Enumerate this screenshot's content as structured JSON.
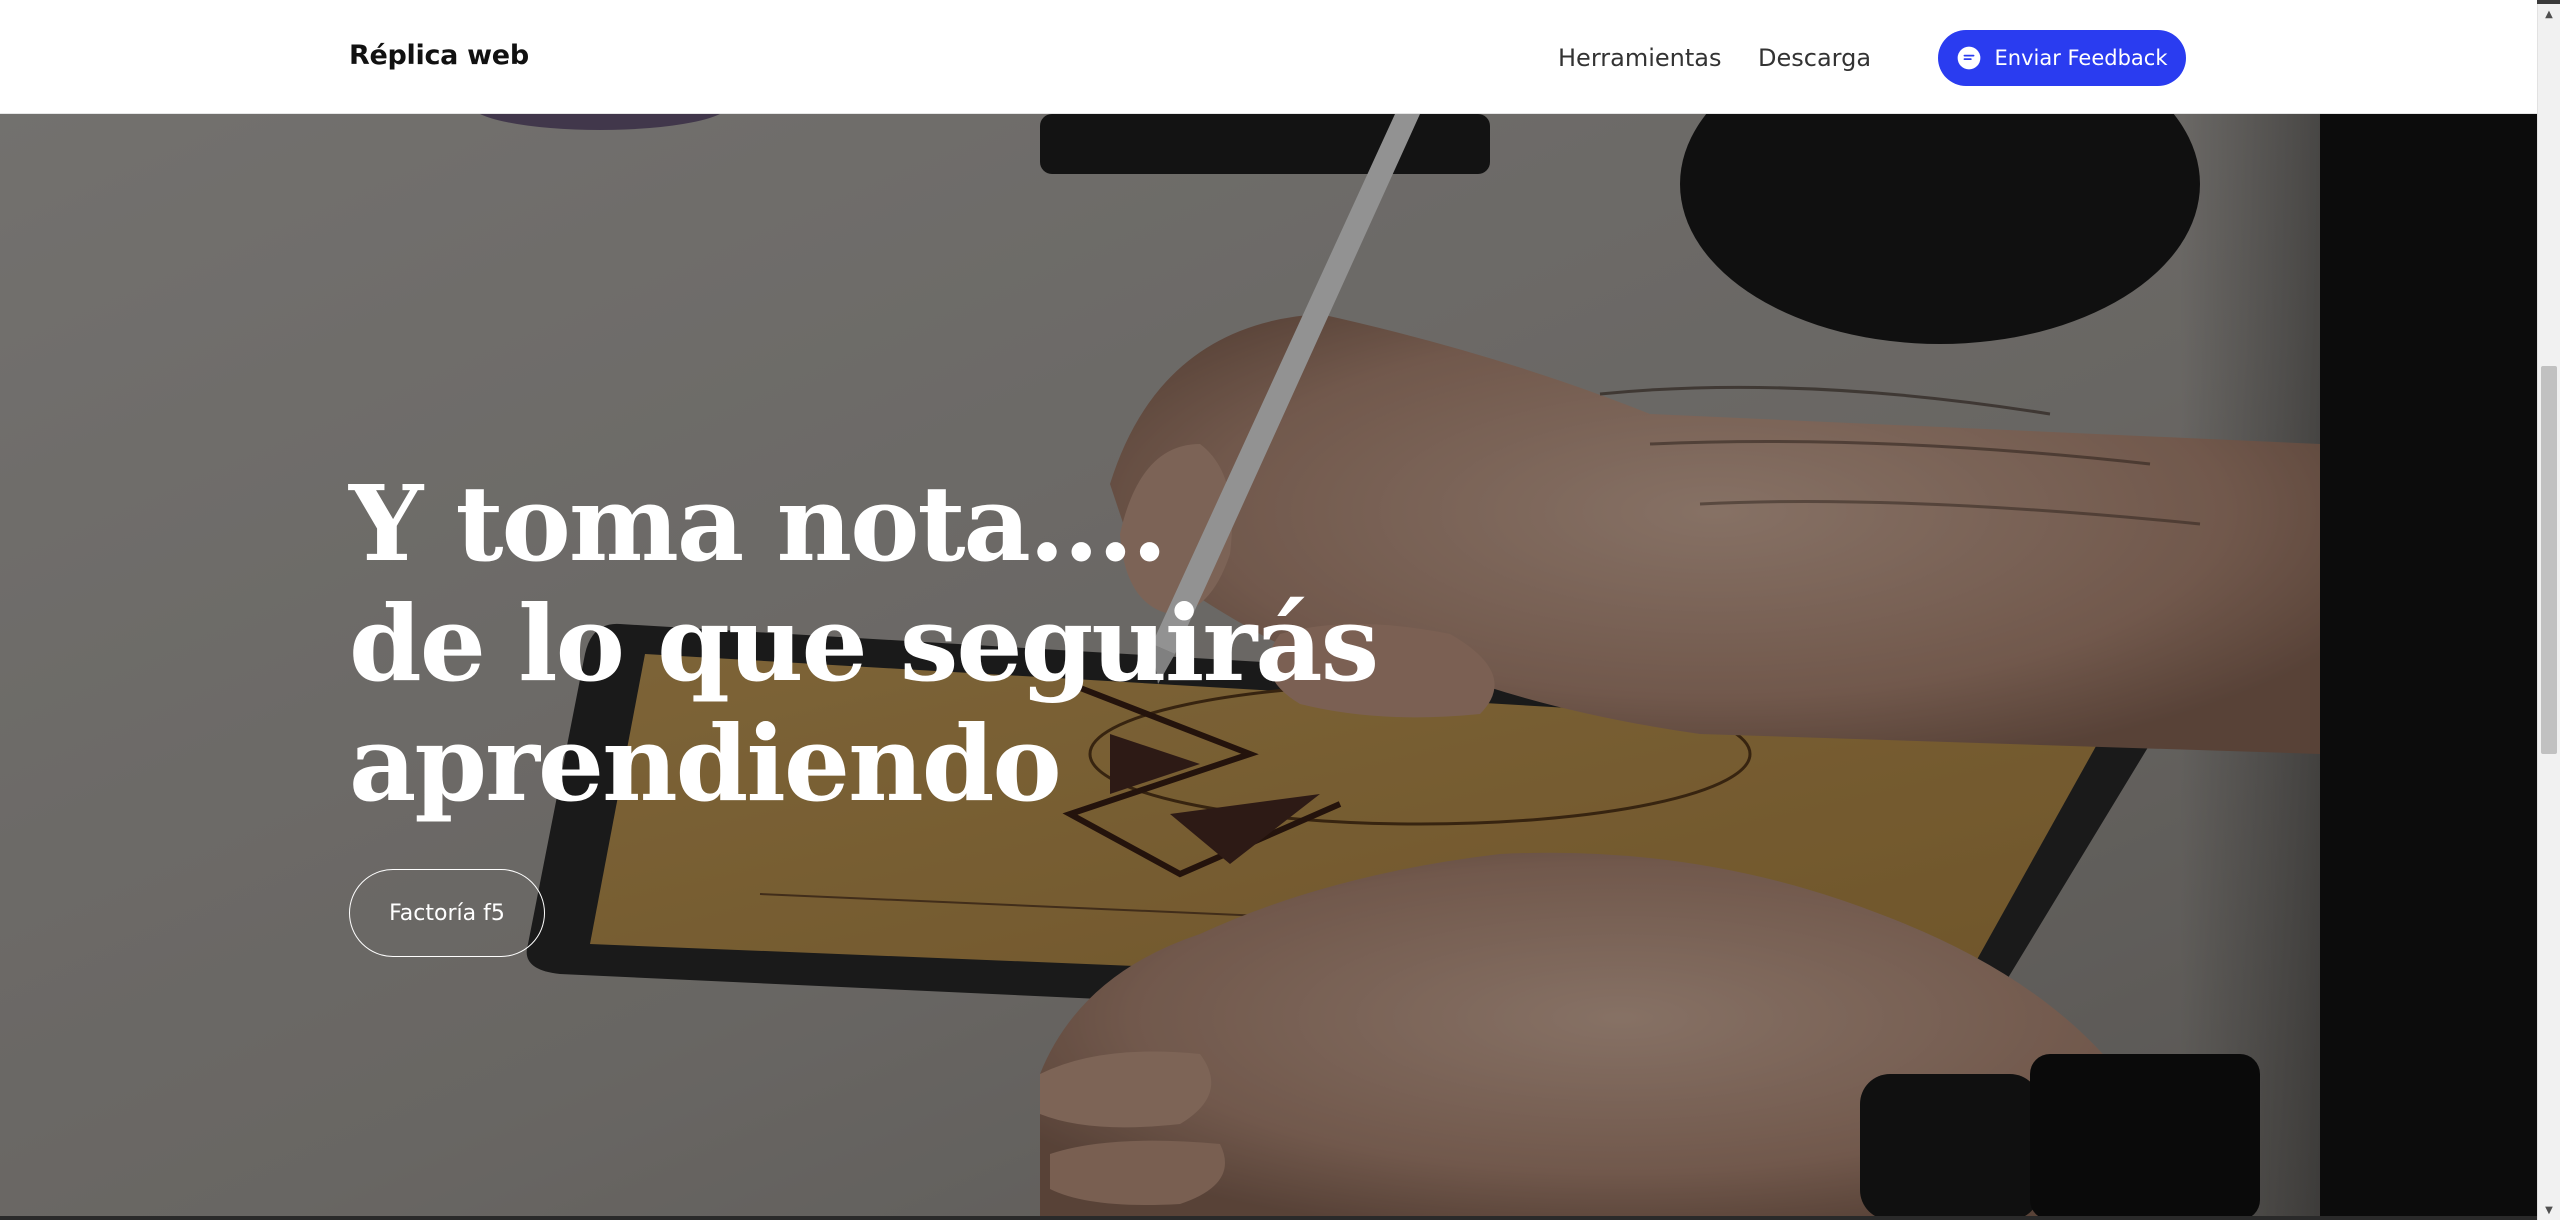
{
  "header": {
    "brand": "Réplica web",
    "nav": {
      "tools": "Herramientas",
      "download": "Descarga"
    },
    "feedback": {
      "label": "Enviar Feedback",
      "icon": "chat-bubble-icon",
      "color": "#2a3cf0"
    }
  },
  "hero": {
    "background": "hand-with-stylus-drawing-on-tablet-photo",
    "title_lines": [
      "Y toma nota....",
      "de lo que seguirás",
      "aprendiendo"
    ],
    "cta_label": "Factoría f5"
  },
  "scrollbar": {
    "up_icon": "chevron-up-icon",
    "down_icon": "chevron-down-icon"
  }
}
